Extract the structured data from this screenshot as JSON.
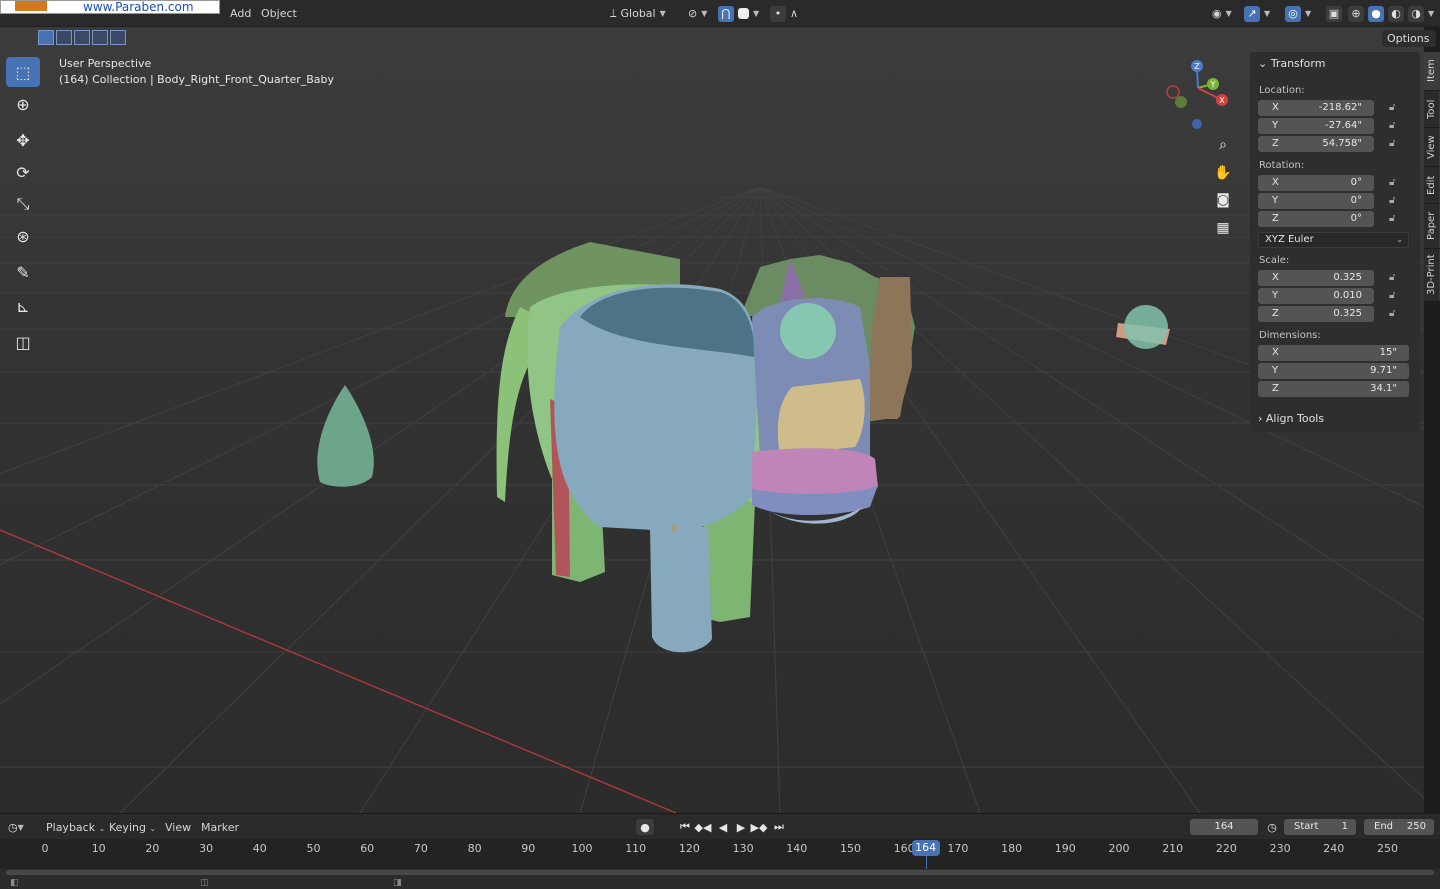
{
  "header": {
    "watermark": "www.Paraben.com",
    "menus": [
      "Add",
      "Object"
    ],
    "transform_orientation": "Global",
    "options_label": "Options"
  },
  "viewport": {
    "perspective_label": "User Perspective",
    "object_info": "(164) Collection | Body_Right_Front_Quarter_Baby",
    "gizmo_axes": [
      "Z",
      "Y",
      "X"
    ]
  },
  "toolbar": {
    "tools": [
      "select-box-icon",
      "cursor-icon",
      "move-icon",
      "rotate-icon",
      "scale-icon",
      "transform-icon",
      "annotate-icon",
      "measure-icon",
      "add-cube-icon"
    ]
  },
  "npanel": {
    "section_title": "Transform",
    "location_label": "Location:",
    "location": [
      {
        "axis": "X",
        "value": "-218.62\""
      },
      {
        "axis": "Y",
        "value": "-27.64\""
      },
      {
        "axis": "Z",
        "value": "54.758\""
      }
    ],
    "rotation_label": "Rotation:",
    "rotation": [
      {
        "axis": "X",
        "value": "0°"
      },
      {
        "axis": "Y",
        "value": "0°"
      },
      {
        "axis": "Z",
        "value": "0°"
      }
    ],
    "rotation_mode": "XYZ Euler",
    "scale_label": "Scale:",
    "scale": [
      {
        "axis": "X",
        "value": "0.325"
      },
      {
        "axis": "Y",
        "value": "0.010"
      },
      {
        "axis": "Z",
        "value": "0.325"
      }
    ],
    "dimensions_label": "Dimensions:",
    "dimensions": [
      {
        "axis": "X",
        "value": "15\""
      },
      {
        "axis": "Y",
        "value": "9.71\""
      },
      {
        "axis": "Z",
        "value": "34.1\""
      }
    ],
    "align_tools_label": "Align Tools"
  },
  "side_tabs": [
    "Item",
    "Tool",
    "View",
    "Edit",
    "Paper",
    "3D-Print"
  ],
  "timeline": {
    "menus": [
      "Playback",
      "Keying",
      "View",
      "Marker"
    ],
    "current_frame": "164",
    "start_label": "Start",
    "start_value": "1",
    "end_label": "End",
    "end_value": "250",
    "ticks": [
      "0",
      "10",
      "20",
      "30",
      "40",
      "50",
      "60",
      "70",
      "80",
      "90",
      "100",
      "110",
      "120",
      "130",
      "140",
      "150",
      "160",
      "170",
      "180",
      "190",
      "200",
      "210",
      "220",
      "230",
      "240",
      "250"
    ]
  },
  "colors": {
    "accent": "#4772b3",
    "viewport_bg": "#393939",
    "panel_bg": "#2e2e2e",
    "axis_x": "#b53a3a"
  }
}
